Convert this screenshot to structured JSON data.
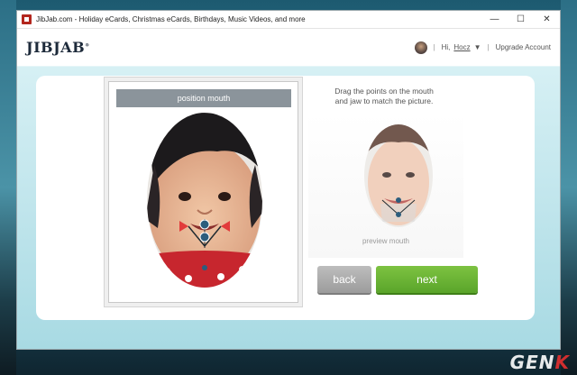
{
  "window": {
    "title": "JibJab.com - Holiday eCards, Christmas eCards, Birthdays, Music Videos, and more",
    "controls": {
      "minimize": "—",
      "maximize": "☐",
      "close": "✕"
    }
  },
  "header": {
    "logo": "JIBJAB",
    "logo_mark": "®",
    "greeting": "Hi,",
    "username": "Hocz",
    "upgrade": "Upgrade Account"
  },
  "editor": {
    "panel_title": "position mouth",
    "instructions_line1": "Drag the points on the mouth",
    "instructions_line2": "and jaw to match the picture.",
    "preview_label": "preview mouth",
    "back_label": "back",
    "next_label": "next"
  },
  "colors": {
    "accent_green": "#66b030",
    "back_gray": "#a8a8a8",
    "handle_red": "#e23b3b",
    "handle_blue": "#2c5d7d"
  },
  "watermark": {
    "text": "GEN",
    "accent": "K"
  }
}
